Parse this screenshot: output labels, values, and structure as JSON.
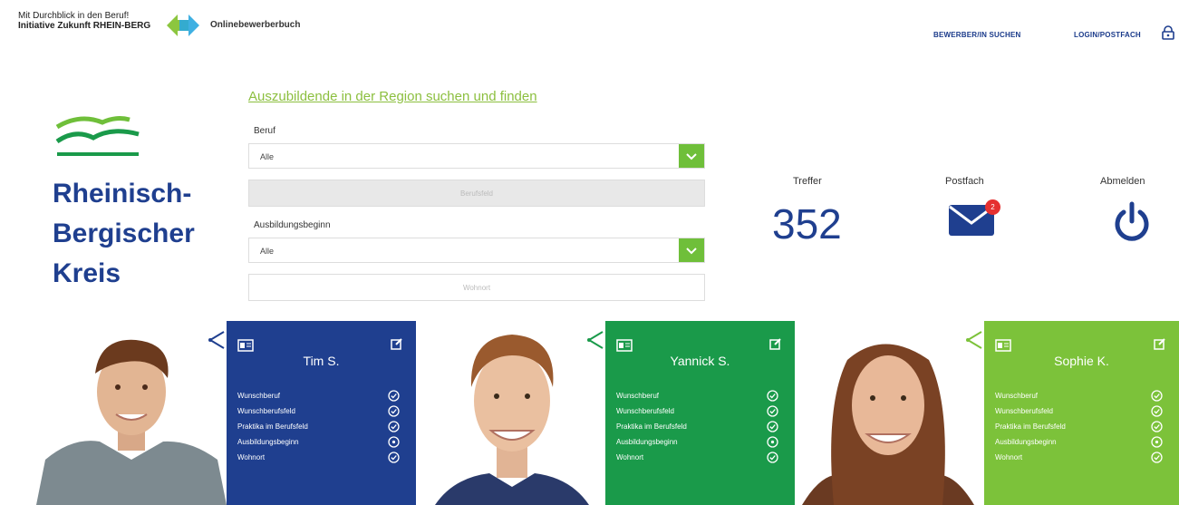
{
  "header": {
    "slogan_line1": "Mit Durchblick in den Beruf!",
    "slogan_line2": "Initiative Zukunft RHEIN-BERG",
    "app_title": "Onlinebewerberbuch",
    "nav_search": "BEWERBER/IN SUCHEN",
    "nav_login": "LOGIN/POSTFACH"
  },
  "brand": {
    "line1": "Rheinisch-",
    "line2": "Bergischer",
    "line3": "Kreis"
  },
  "search": {
    "title": "Auszubildende in der Region suchen und finden",
    "beruf_label": "Beruf",
    "beruf_value": "Alle",
    "bereich_button": "Berufsfeld",
    "beginn_label": "Ausbildungsbeginn",
    "beginn_value": "Alle",
    "wohnort_button": "Wohnort"
  },
  "stats": {
    "treffer_label": "Treffer",
    "treffer_value": "352",
    "postfach_label": "Postfach",
    "postfach_badge": "2",
    "abmelden_label": "Abmelden"
  },
  "cards": [
    {
      "name": "Tim S.",
      "color": "#1f3f8f"
    },
    {
      "name": "Yannick S.",
      "color": "#1a9a4a"
    },
    {
      "name": "Sophie K.",
      "color": "#7cc23a"
    }
  ],
  "criteria": [
    "Wunschberuf",
    "Wunschberufsfeld",
    "Praktika im Berufsfeld",
    "Ausbildungsbeginn",
    "Wohnort"
  ],
  "colors": {
    "brand_blue": "#1f3f8f",
    "accent_green": "#6fbf3a",
    "title_green": "#8cbf3f"
  }
}
